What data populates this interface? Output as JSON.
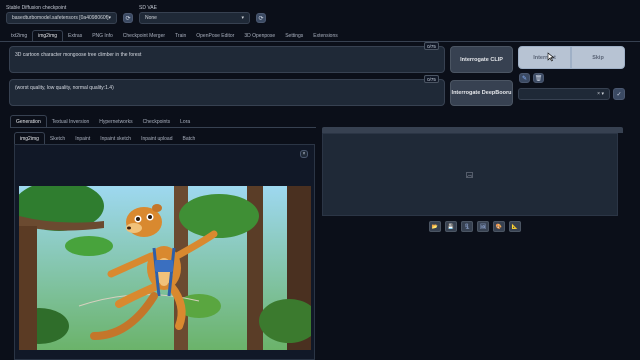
{
  "header": {
    "checkpoint_label": "Stable Diffusion checkpoint",
    "checkpoint_value": "basedturbomodel.safetensors [0a4098060f]",
    "vae_label": "SD VAE",
    "vae_value": "None"
  },
  "main_tabs": [
    "txt2img",
    "img2img",
    "Extras",
    "PNG Info",
    "Checkpoint Merger",
    "Train",
    "OpenPose Editor",
    "3D Openpose",
    "Settings",
    "Extensions"
  ],
  "prompt": {
    "positive": "3D cartoon character mongoose tree climber in the forest",
    "negative": "(worst quality, low quality, normal quality:1.4)",
    "positive_count": "0/75",
    "negative_count": "0/75"
  },
  "buttons": {
    "interrogate_clip": "Interrogate CLIP",
    "interrogate_deepbooru": "Interrogate DeepBooru",
    "interrupt": "Interrupt",
    "skip": "Skip"
  },
  "sub_tabs": [
    "Generation",
    "Textual Inversion",
    "Hypernetworks",
    "Checkpoints",
    "Lora"
  ],
  "mode_tabs": [
    "img2img",
    "Sketch",
    "Inpaint",
    "Inpaint sketch",
    "Inpaint upload",
    "Batch"
  ],
  "colors": {
    "bg": "#0b0f19",
    "panel": "#1f2937",
    "accent": "#3b82f6"
  }
}
